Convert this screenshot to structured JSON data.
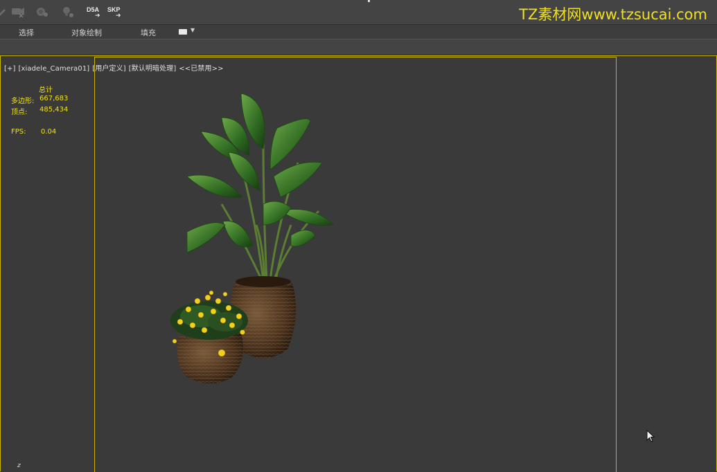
{
  "toolbar": {
    "icons": [
      "link-icon",
      "camera-x-icon",
      "render-setup-icon",
      "light-icon"
    ],
    "d5a_label": "D5A",
    "skp_label": "SKP",
    "arrow_glyph": "➜"
  },
  "watermark": "TZ素材网www.tzsucai.com",
  "ribbon": {
    "tabs": [
      "选择",
      "对象绘制",
      "填充"
    ]
  },
  "viewport": {
    "label_parts": [
      "[+]",
      "[xiadele_Camera01]",
      "[用户定义]",
      "[默认明暗处理]",
      "<<已禁用>>"
    ],
    "stats": {
      "header": "总计",
      "polygons_label": "多边形:",
      "polygons_value": "667,683",
      "vertices_label": "顶点:",
      "vertices_value": "485,434",
      "fps_label": "FPS:",
      "fps_value": "0.04"
    },
    "axis_label": "z"
  },
  "colors": {
    "accent_yellow": "#f0e020",
    "frame_yellow": "#c9b400",
    "viewport_bg": "#3a3a3a",
    "toolbar_bg": "#444444"
  }
}
